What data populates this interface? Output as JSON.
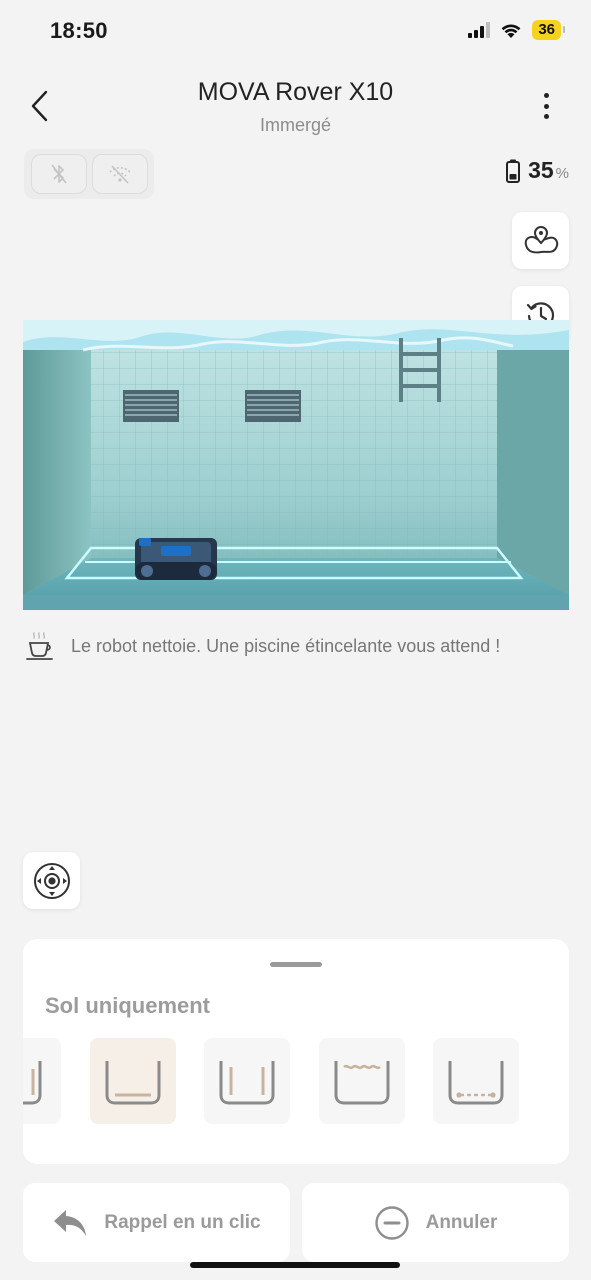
{
  "status_bar": {
    "time": "18:50",
    "battery_level": "36",
    "icons": [
      "cellular-signal-icon",
      "wifi-icon",
      "battery-icon"
    ]
  },
  "header": {
    "title": "MOVA Rover X10",
    "subtitle": "Immergé",
    "icons": [
      "back-chevron-icon",
      "more-vertical-icon"
    ]
  },
  "connectivity": {
    "icons": [
      "bluetooth-off-icon",
      "wifi-off-icon"
    ]
  },
  "device_battery": {
    "value": "35",
    "unit": "%",
    "icon": "battery-icon"
  },
  "side_buttons": [
    "pool-map-icon",
    "history-icon"
  ],
  "scene": {
    "description_icon": "coffee-cup-icon"
  },
  "status_message": "Le robot nettoie. Une piscine étincelante vous attend !",
  "joystick": {
    "icon": "joystick-icon"
  },
  "cleaning_panel": {
    "mode_label": "Sol uniquement",
    "modes": [
      {
        "id": "walls",
        "icon": "pool-walls-icon",
        "selected": false
      },
      {
        "id": "floor-only",
        "icon": "pool-floor-icon",
        "selected": true
      },
      {
        "id": "floor-and-walls",
        "icon": "pool-floor-walls-icon",
        "selected": false
      },
      {
        "id": "waterline",
        "icon": "pool-waterline-icon",
        "selected": false
      },
      {
        "id": "custom",
        "icon": "pool-dotted-floor-icon",
        "selected": false
      }
    ]
  },
  "actions": {
    "recall_label": "Rappel en un clic",
    "cancel_label": "Annuler"
  },
  "colors": {
    "background": "#f3f3f3",
    "accent_selected": "#f6efe7",
    "accent_tan": "#c8b39c",
    "battery_pill": "#f5d21d",
    "water": "#9fd7dc"
  }
}
